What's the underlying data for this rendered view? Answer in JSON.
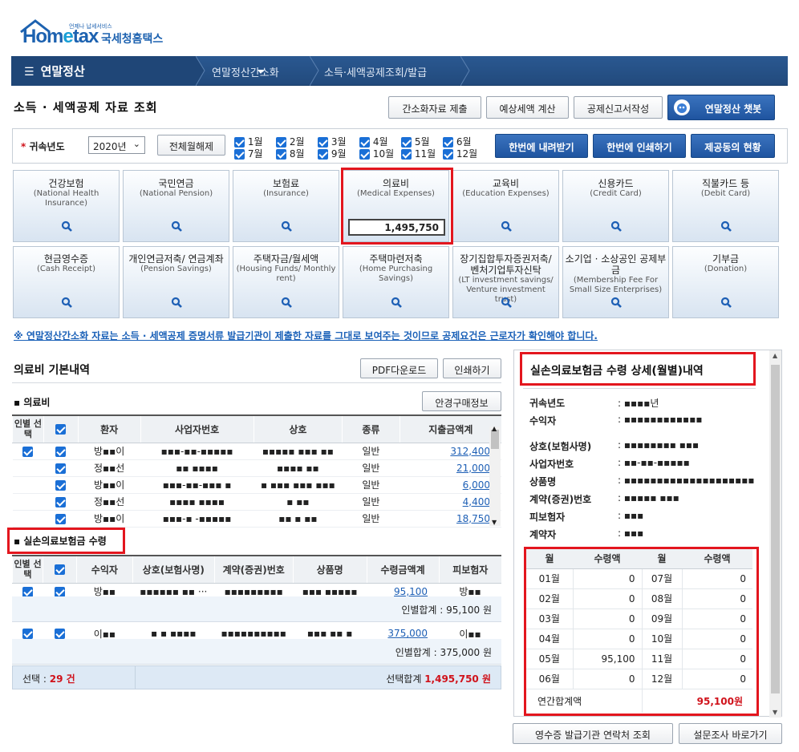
{
  "logo": {
    "brand_a": "Hom",
    "brand_e": "e",
    "brand_b": "tax",
    "slogan": "언제나 납세서비스",
    "site": "국세청홈택스"
  },
  "nav": {
    "menu": "연말정산",
    "crumb1": "연말정산간소화",
    "crumb2": "소득·세액공제조회/발급"
  },
  "page": {
    "title": "소득 · 세액공제 자료 조회"
  },
  "top_buttons": [
    "간소화자료 제출",
    "예상세액 계산",
    "공제신고서작성",
    "연말정산 챗봇"
  ],
  "filter": {
    "year_label": "귀속년도",
    "year_value": "2020년",
    "deselect_all": "전체월해제",
    "months": [
      "1월",
      "2월",
      "3월",
      "4월",
      "5월",
      "6월",
      "7월",
      "8월",
      "9월",
      "10월",
      "11월",
      "12월"
    ],
    "buttons": [
      "한번에 내려받기",
      "한번에 인쇄하기",
      "제공동의 현황"
    ]
  },
  "tiles": [
    {
      "t": "건강보험",
      "s": "(National Health Insurance)"
    },
    {
      "t": "국민연금",
      "s": "(National Pension)"
    },
    {
      "t": "보험료",
      "s": "(Insurance)"
    },
    {
      "t": "의료비",
      "s": "(Medical Expenses)",
      "amount": "1,495,750"
    },
    {
      "t": "교육비",
      "s": "(Education Expenses)"
    },
    {
      "t": "신용카드",
      "s": "(Credit Card)"
    },
    {
      "t": "직불카드 등",
      "s": "(Debit Card)"
    },
    {
      "t": "현금영수증",
      "s": "(Cash Receipt)"
    },
    {
      "t": "개인연금저축/ 연금계좌",
      "s": "(Pension Savings)"
    },
    {
      "t": "주택자금/월세액",
      "s": "(Housing Funds/ Monthly rent)"
    },
    {
      "t": "주택마련저축",
      "s": "(Home Purchasing Savings)"
    },
    {
      "t": "장기집합투자증권저축/ 벤처기업투자신탁",
      "s": "(LT investment savings/ Venture investment trust)"
    },
    {
      "t": "소기업 · 소상공인 공제부금",
      "s": "(Membership Fee For Small Size Enterprises)"
    },
    {
      "t": "기부금",
      "s": "(Donation)"
    }
  ],
  "notice": "※ 연말정산간소화 자료는 소득 · 세액공제 증명서류 발급기관이 제출한 자료를 그대로 보여주는 것이므로 공제요건은 근로자가 확인해야 합니다.",
  "medical": {
    "section_title": "의료비 기본내역",
    "pdf": "PDF다운로드",
    "print": "인쇄하기",
    "sub_title": "의료비",
    "glasses": "안경구매정보",
    "headers": [
      "인별 선택",
      "",
      "환자",
      "사업자번호",
      "상호",
      "종류",
      "지출금액계"
    ],
    "rows": [
      {
        "patient": "방▪▪이",
        "bizno": "▪▪▪-▪▪-▪▪▪▪▪",
        "name": "▪▪▪▪▪ ▪▪▪ ▪▪",
        "kind": "일반",
        "amount": "312,400"
      },
      {
        "patient": "정▪▪선",
        "bizno": "▪▪ ▪▪▪▪",
        "name": "▪▪▪▪ ▪▪",
        "kind": "일반",
        "amount": "21,000"
      },
      {
        "patient": "방▪▪이",
        "bizno": "▪▪▪-▪▪-▪▪▪ ▪",
        "name": "▪ ▪▪▪ ▪▪▪ ▪▪▪",
        "kind": "일반",
        "amount": "6,000"
      },
      {
        "patient": "정▪▪선",
        "bizno": "▪▪▪▪ ▪▪▪▪",
        "name": "▪ ▪▪",
        "kind": "일반",
        "amount": "4,400"
      },
      {
        "patient": "방▪▪이",
        "bizno": "▪▪▪-▪ -▪▪▪▪▪",
        "name": "▪▪ ▪ ▪▪",
        "kind": "일반",
        "amount": "18,750"
      }
    ]
  },
  "insurance": {
    "sub_title": "실손의료보험금 수령",
    "headers": [
      "인별 선택",
      "",
      "수익자",
      "상호(보험사명)",
      "계약(증권)번호",
      "상품명",
      "수령금액계",
      "피보험자"
    ],
    "rows": [
      {
        "recipient": "방▪▪",
        "company": "▪▪▪▪▪▪ ▪▪ ···",
        "contract": "▪▪▪▪▪▪▪▪▪",
        "product": "▪▪▪ ▪▪▪▪▪",
        "amount": "95,100",
        "insured": "방▪▪",
        "subtotal": "인별합계 : 95,100 원"
      },
      {
        "recipient": "이▪▪",
        "company": "▪ ▪ ▪▪▪▪",
        "contract": "▪▪▪▪▪▪▪▪▪▪",
        "product": "▪▪▪ ▪▪ ▪",
        "amount": "375,000",
        "insured": "이▪▪",
        "subtotal": "인별합계 : 375,000 원"
      }
    ]
  },
  "summary": {
    "sel_label": "선택 : ",
    "sel_count": "29 건",
    "total_label": "선택합계 ",
    "total_value": "1,495,750 원"
  },
  "detail": {
    "title": "실손의료보험금 수령 상세(월별)내역",
    "fields": [
      {
        "k": "귀속년도",
        "v": "▪▪▪▪년"
      },
      {
        "k": "수익자",
        "v": "▪▪▪▪▪▪▪▪▪▪▪▪"
      },
      {
        "k": "상호(보험사명)",
        "v": "▪▪▪▪▪▪▪▪ ▪▪▪"
      },
      {
        "k": "사업자번호",
        "v": "▪▪-▪▪-▪▪▪▪▪"
      },
      {
        "k": "상품명",
        "v": "▪▪▪▪▪▪▪▪▪▪▪▪▪▪▪▪▪▪▪▪"
      },
      {
        "k": "계약(증권)번호",
        "v": "▪▪▪▪▪ ▪▪▪"
      },
      {
        "k": "피보험자",
        "v": "▪▪▪"
      },
      {
        "k": "계약자",
        "v": "▪▪▪"
      }
    ],
    "headers": [
      "월",
      "수령액",
      "월",
      "수령액"
    ],
    "months": [
      [
        "01월",
        "0",
        "07월",
        "0"
      ],
      [
        "02월",
        "0",
        "08월",
        "0"
      ],
      [
        "03월",
        "0",
        "09월",
        "0"
      ],
      [
        "04월",
        "0",
        "10월",
        "0"
      ],
      [
        "05월",
        "95,100",
        "11월",
        "0"
      ],
      [
        "06월",
        "0",
        "12월",
        "0"
      ]
    ],
    "annual_label": "연간합계액",
    "annual_value": "95,100원"
  },
  "bottom_buttons": [
    "영수증 발급기관 연락처 조회",
    "설문조사 바로가기"
  ],
  "colors": {
    "accent_red": "#e3161e",
    "nav_blue": "#224a7c",
    "link_blue": "#1d5fb5"
  }
}
